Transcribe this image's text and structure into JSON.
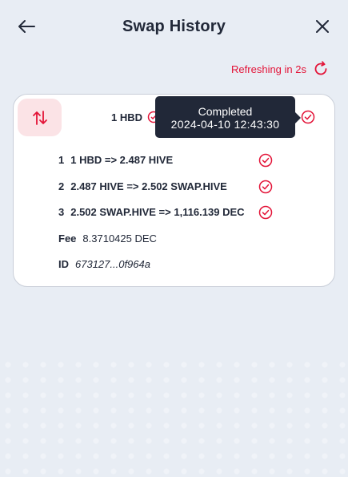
{
  "header": {
    "title": "Swap History"
  },
  "refresh": {
    "label": "Refreshing in 2s"
  },
  "swap": {
    "summary_amount": "1 HBD",
    "tooltip": {
      "status": "Completed",
      "timestamp": "2024-04-10 12:43:30"
    },
    "steps": [
      {
        "index": "1",
        "text": "1 HBD => 2.487 HIVE"
      },
      {
        "index": "2",
        "text": "2.487 HIVE => 2.502 SWAP.HIVE"
      },
      {
        "index": "3",
        "text": "2.502 SWAP.HIVE => 1,116.139 DEC"
      }
    ],
    "fee": {
      "label": "Fee",
      "value": "8.3710425 DEC"
    },
    "id": {
      "label": "ID",
      "value": "673127...0f964a"
    }
  },
  "colors": {
    "accent": "#e31337",
    "background": "#e8edf4",
    "text": "#212838",
    "tooltip_bg": "#212838",
    "icon_box_bg": "#fbe3e6"
  },
  "icons": {
    "back": "arrow-left-icon",
    "close": "close-icon",
    "refresh": "refresh-icon",
    "swap": "swap-arrows-icon",
    "status": "check-circle-icon"
  }
}
